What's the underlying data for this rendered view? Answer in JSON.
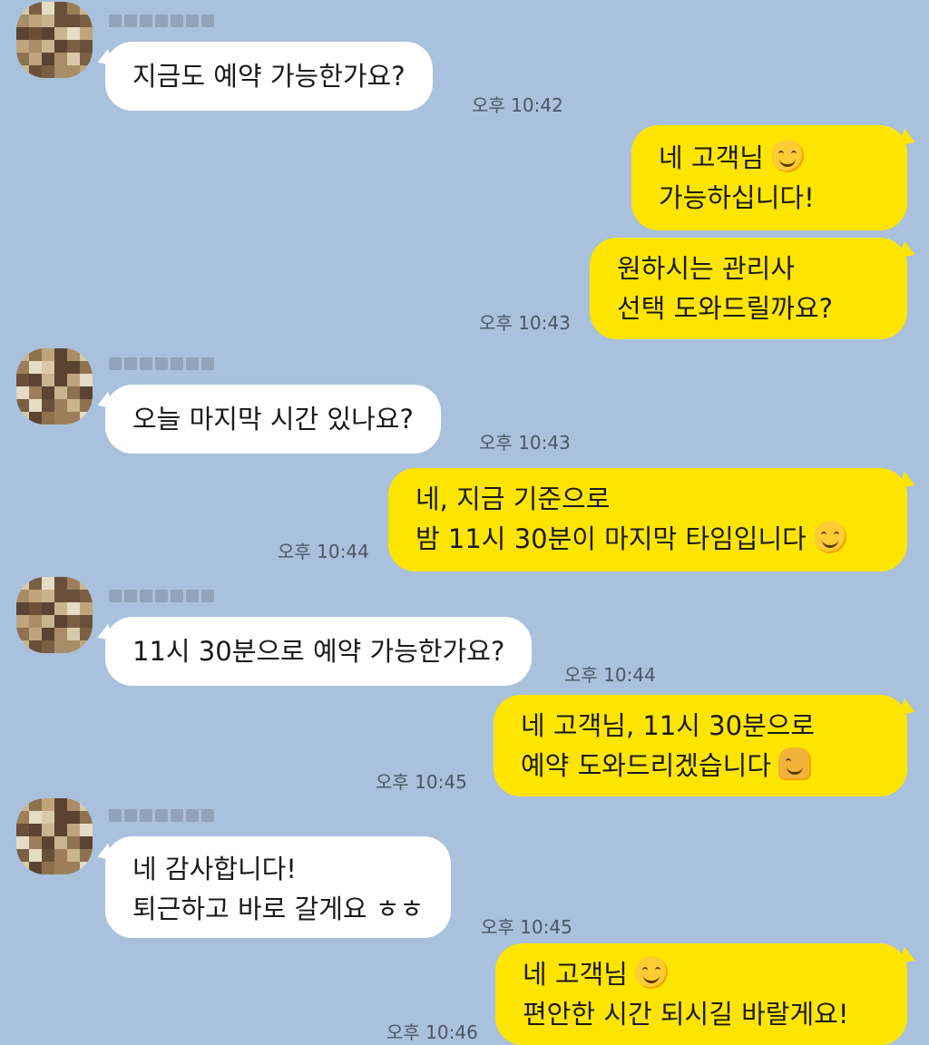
{
  "colors": {
    "background": "#a9c1dc",
    "incoming_bubble": "#ffffff",
    "outgoing_bubble": "#fee500",
    "timestamp": "#4c5665"
  },
  "messages": [
    {
      "dir": "in",
      "lines": [
        "지금도 예약 가능한가요?"
      ],
      "time": "오후 10:42"
    },
    {
      "dir": "out",
      "lines": [
        "네 고객님",
        "가능하십니다!"
      ],
      "emoji": "smiling-face-icon"
    },
    {
      "dir": "out",
      "lines": [
        "원하시는 관리사",
        "선택 도와드릴까요?"
      ],
      "time": "오후 10:43"
    },
    {
      "dir": "in",
      "lines": [
        "오늘 마지막 시간 있나요?"
      ],
      "time": "오후 10:43"
    },
    {
      "dir": "out",
      "lines": [
        "네, 지금 기준으로",
        "밤 11시 30분이 마지막 타임입니다"
      ],
      "time": "오후 10:44",
      "emoji": "smiling-face-icon"
    },
    {
      "dir": "in",
      "lines": [
        "11시 30분으로 예약 가능한가요?"
      ],
      "time": "오후 10:44"
    },
    {
      "dir": "out",
      "lines": [
        "네 고객님, 11시 30분으로",
        "예약 도와드리겠습니다"
      ],
      "time": "오후 10:45",
      "emoji": "person-bowing-icon"
    },
    {
      "dir": "in",
      "lines": [
        "네 감사합니다!",
        "퇴근하고 바로 갈게요 ㅎㅎ"
      ],
      "time": "오후 10:45"
    },
    {
      "dir": "out",
      "lines": [
        "네 고객님",
        "편안한 시간 되시길 바랄게요!"
      ],
      "time": "오후 10:46",
      "emoji": "smiling-face-icon"
    }
  ]
}
